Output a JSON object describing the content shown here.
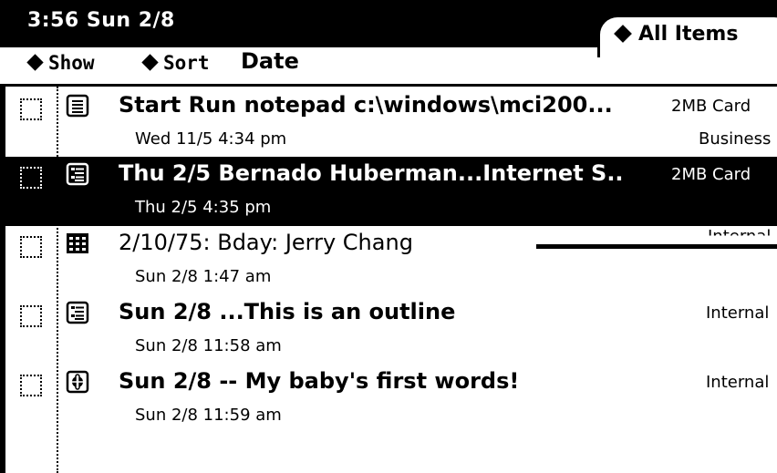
{
  "status": {
    "clock": "3:56 Sun 2/8"
  },
  "tab": {
    "label": "All Items"
  },
  "menubar": {
    "show_label": "Show",
    "sort_label": "Sort",
    "sort_value": "Date"
  },
  "items": [
    {
      "icon": "notepad-icon",
      "title": "Start Run notepad c:\\windows\\mci200...",
      "store": "2MB Card",
      "stamp": "Wed 11/5 4:34 pm",
      "folder": "Business",
      "bold": true,
      "selected": false
    },
    {
      "icon": "outline-icon",
      "title": "Thu 2/5 Bernado Huberman...Internet S..",
      "store": "2MB Card",
      "stamp": "Thu 2/5 4:35 pm",
      "folder": "",
      "bold": true,
      "selected": true
    },
    {
      "icon": "calendar-icon",
      "title": "2/10/75: Bday: Jerry Chang",
      "store": "Internal",
      "stamp": "Sun 2/8 1:47 am",
      "folder": "",
      "bold": false,
      "selected": false
    },
    {
      "icon": "outline-icon",
      "title": "Sun 2/8 ...This is an outline",
      "store": "Internal",
      "stamp": "Sun 2/8 11:58 am",
      "folder": "",
      "bold": true,
      "selected": false
    },
    {
      "icon": "audio-note-icon",
      "title": "Sun 2/8 -- My baby's first words!",
      "store": "Internal",
      "stamp": "Sun 2/8 11:59 am",
      "folder": "",
      "bold": true,
      "selected": false
    }
  ]
}
